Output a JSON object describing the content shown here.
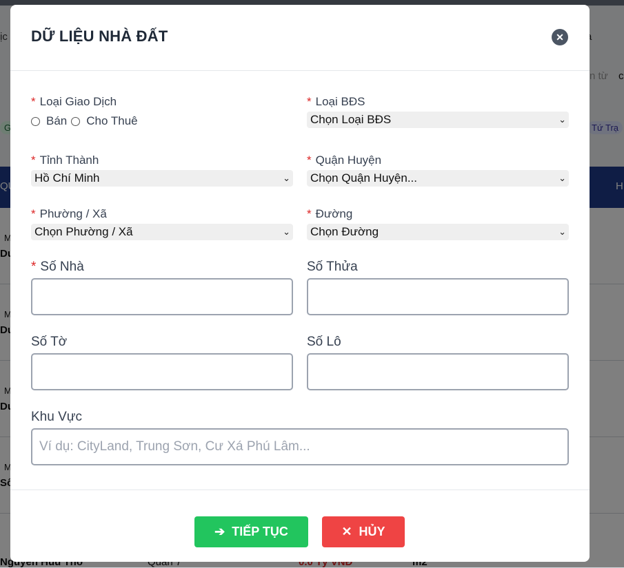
{
  "background": {
    "partial_texts": [
      "ịc",
      "a",
      "n từ",
      "c",
      "Gia",
      "Tứ Trạ",
      "QU",
      "H",
      "M",
      "Du",
      "M",
      "Du",
      "M",
      "Du",
      "M",
      "Số"
    ],
    "footer_row": [
      "Nguyen Huu Tho",
      "Quan 7",
      "0.0 Tỷ VNĐ",
      "m2"
    ]
  },
  "modal": {
    "title": "DỮ LIỆU NHÀ ĐẤT",
    "close_icon": "close-icon",
    "required_mark": "*",
    "transaction_type": {
      "label": "Loại Giao Dịch",
      "options": [
        "Bán",
        "Cho Thuê"
      ]
    },
    "property_type": {
      "label": "Loại BĐS",
      "value": "Chọn Loại BĐS"
    },
    "province": {
      "label": "Tỉnh Thành",
      "value": "Hồ Chí Minh"
    },
    "district": {
      "label": "Quận Huyện",
      "value": "Chọn Quận Huyện..."
    },
    "ward": {
      "label": "Phường / Xã",
      "value": "Chọn Phường / Xã"
    },
    "street": {
      "label": "Đường",
      "value": "Chọn Đường"
    },
    "house_number": {
      "label": "Số Nhà",
      "value": ""
    },
    "plot_number": {
      "label": "Số Thửa",
      "value": ""
    },
    "sheet_number": {
      "label": "Số Tờ",
      "value": ""
    },
    "lot_number": {
      "label": "Số Lô",
      "value": ""
    },
    "area": {
      "label": "Khu Vực",
      "value": "",
      "placeholder": "Ví dụ: CityLand, Trung Sơn, Cư Xá Phú Lâm..."
    },
    "continue_button": {
      "label": "TIẾP TỤC",
      "icon": "arrow-right-icon"
    },
    "cancel_button": {
      "label": "HỦY",
      "icon": "x-icon"
    },
    "chevron_icon": "chevron-down-icon"
  },
  "colors": {
    "continue": "#22c55e",
    "cancel": "#ef4444",
    "required": "#dc2626",
    "header_bar": "#1e3a8a"
  }
}
